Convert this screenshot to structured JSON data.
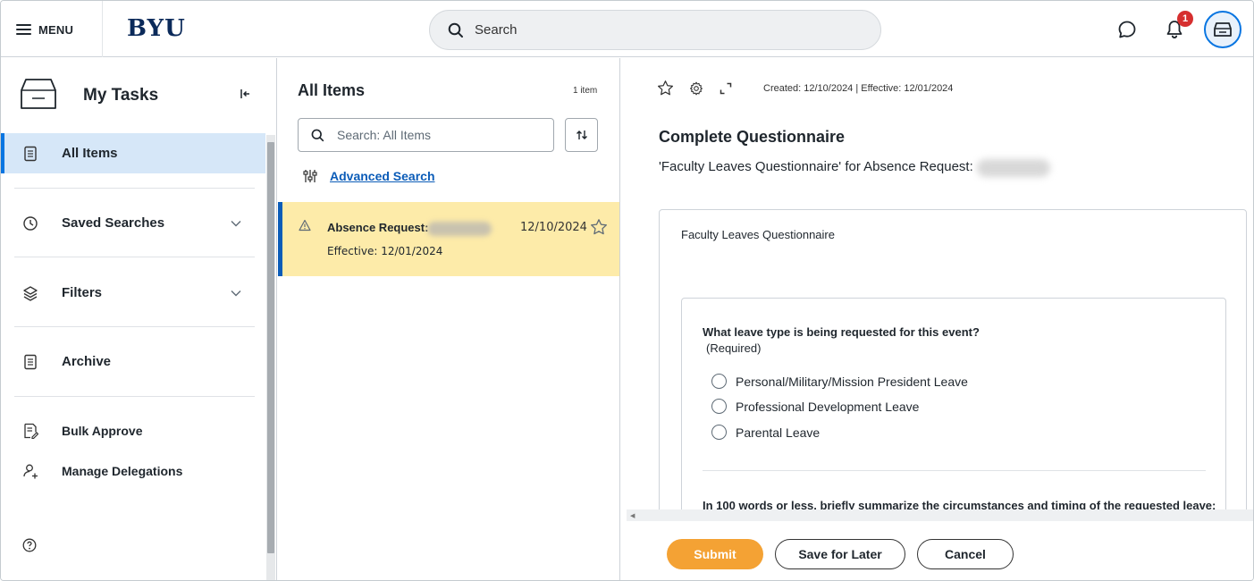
{
  "topbar": {
    "menu_label": "MENU",
    "logo_text": "BYU",
    "search_placeholder": "Search",
    "notification_count": "1"
  },
  "sidebar": {
    "title": "My Tasks",
    "items": [
      {
        "label": "All Items",
        "icon": "clipboard-icon",
        "active": true
      },
      {
        "label": "Saved Searches",
        "icon": "history-icon",
        "expandable": true
      },
      {
        "label": "Filters",
        "icon": "layers-icon",
        "expandable": true
      },
      {
        "label": "Archive",
        "icon": "clipboard-icon"
      },
      {
        "label": "Bulk Approve",
        "icon": "edit-document-icon"
      },
      {
        "label": "Manage Delegations",
        "icon": "user-add-icon"
      }
    ],
    "help_icon": "help-icon"
  },
  "middle": {
    "title": "All Items",
    "count": "1 item",
    "search_placeholder": "Search: All Items",
    "advanced_search": "Advanced Search",
    "task": {
      "name": "Absence Request:",
      "date": "12/10/2024",
      "effective": "Effective: 12/01/2024"
    }
  },
  "detail": {
    "meta": "Created: 12/10/2024 | Effective: 12/01/2024",
    "title": "Complete Questionnaire",
    "subtitle": "'Faculty Leaves Questionnaire' for Absence Request:",
    "card_title": "Faculty Leaves Questionnaire",
    "question1": "What leave type is being requested for this event?",
    "required": "(Required)",
    "options": [
      "Personal/Military/Mission President Leave",
      "Professional Development Leave",
      "Parental Leave"
    ],
    "question2": "In 100 words or less, briefly summarize the circumstances and timing of the requested leave:"
  },
  "footer": {
    "submit": "Submit",
    "save_later": "Save for Later",
    "cancel": "Cancel"
  },
  "colors": {
    "accent_blue": "#0875e1",
    "task_highlight": "#fdeba9",
    "submit_orange": "#f4a234",
    "badge_red": "#d62f2f",
    "logo_navy": "#0b2a5a"
  }
}
